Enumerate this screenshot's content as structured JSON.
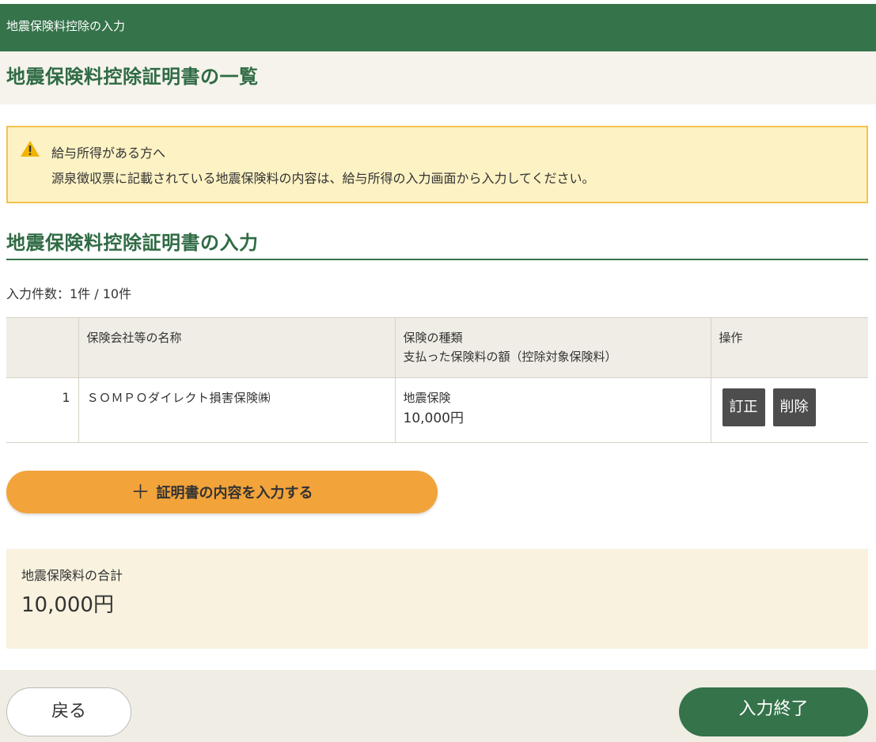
{
  "header": {
    "title": "地震保険料控除の入力"
  },
  "page_title": "地震保険料控除証明書の一覧",
  "notice": {
    "icon": "warning-icon",
    "line1": "給与所得がある方へ",
    "line2": "源泉徴収票に記載されている地震保険料の内容は、給与所得の入力画面から入力してください。"
  },
  "section_title": "地震保険料控除証明書の入力",
  "count_text": "入力件数：1件 / 10件",
  "table": {
    "headers": {
      "num": "",
      "name": "保険会社等の名称",
      "type_line1": "保険の種類",
      "type_line2": "支払った保険料の額（控除対象保険料）",
      "ops": "操作"
    },
    "rows": [
      {
        "num": "1",
        "name": "ＳＯＭＰＯダイレクト損害保険㈱",
        "type": "地震保険",
        "amount": "10,000円",
        "edit_label": "訂正",
        "delete_label": "削除"
      }
    ]
  },
  "add_button": {
    "icon": "plus-icon",
    "label": "証明書の内容を入力する"
  },
  "total": {
    "label": "地震保険料の合計",
    "value": "10,000円"
  },
  "footer": {
    "back_label": "戻る",
    "finish_label": "入力終了"
  },
  "colors": {
    "brand_green": "#35734a",
    "title_green": "#2f6b44",
    "accent_orange": "#f2a33a",
    "notice_bg": "#fdf2c4",
    "notice_border": "#f2c24f",
    "total_bg": "#f8f2df"
  }
}
